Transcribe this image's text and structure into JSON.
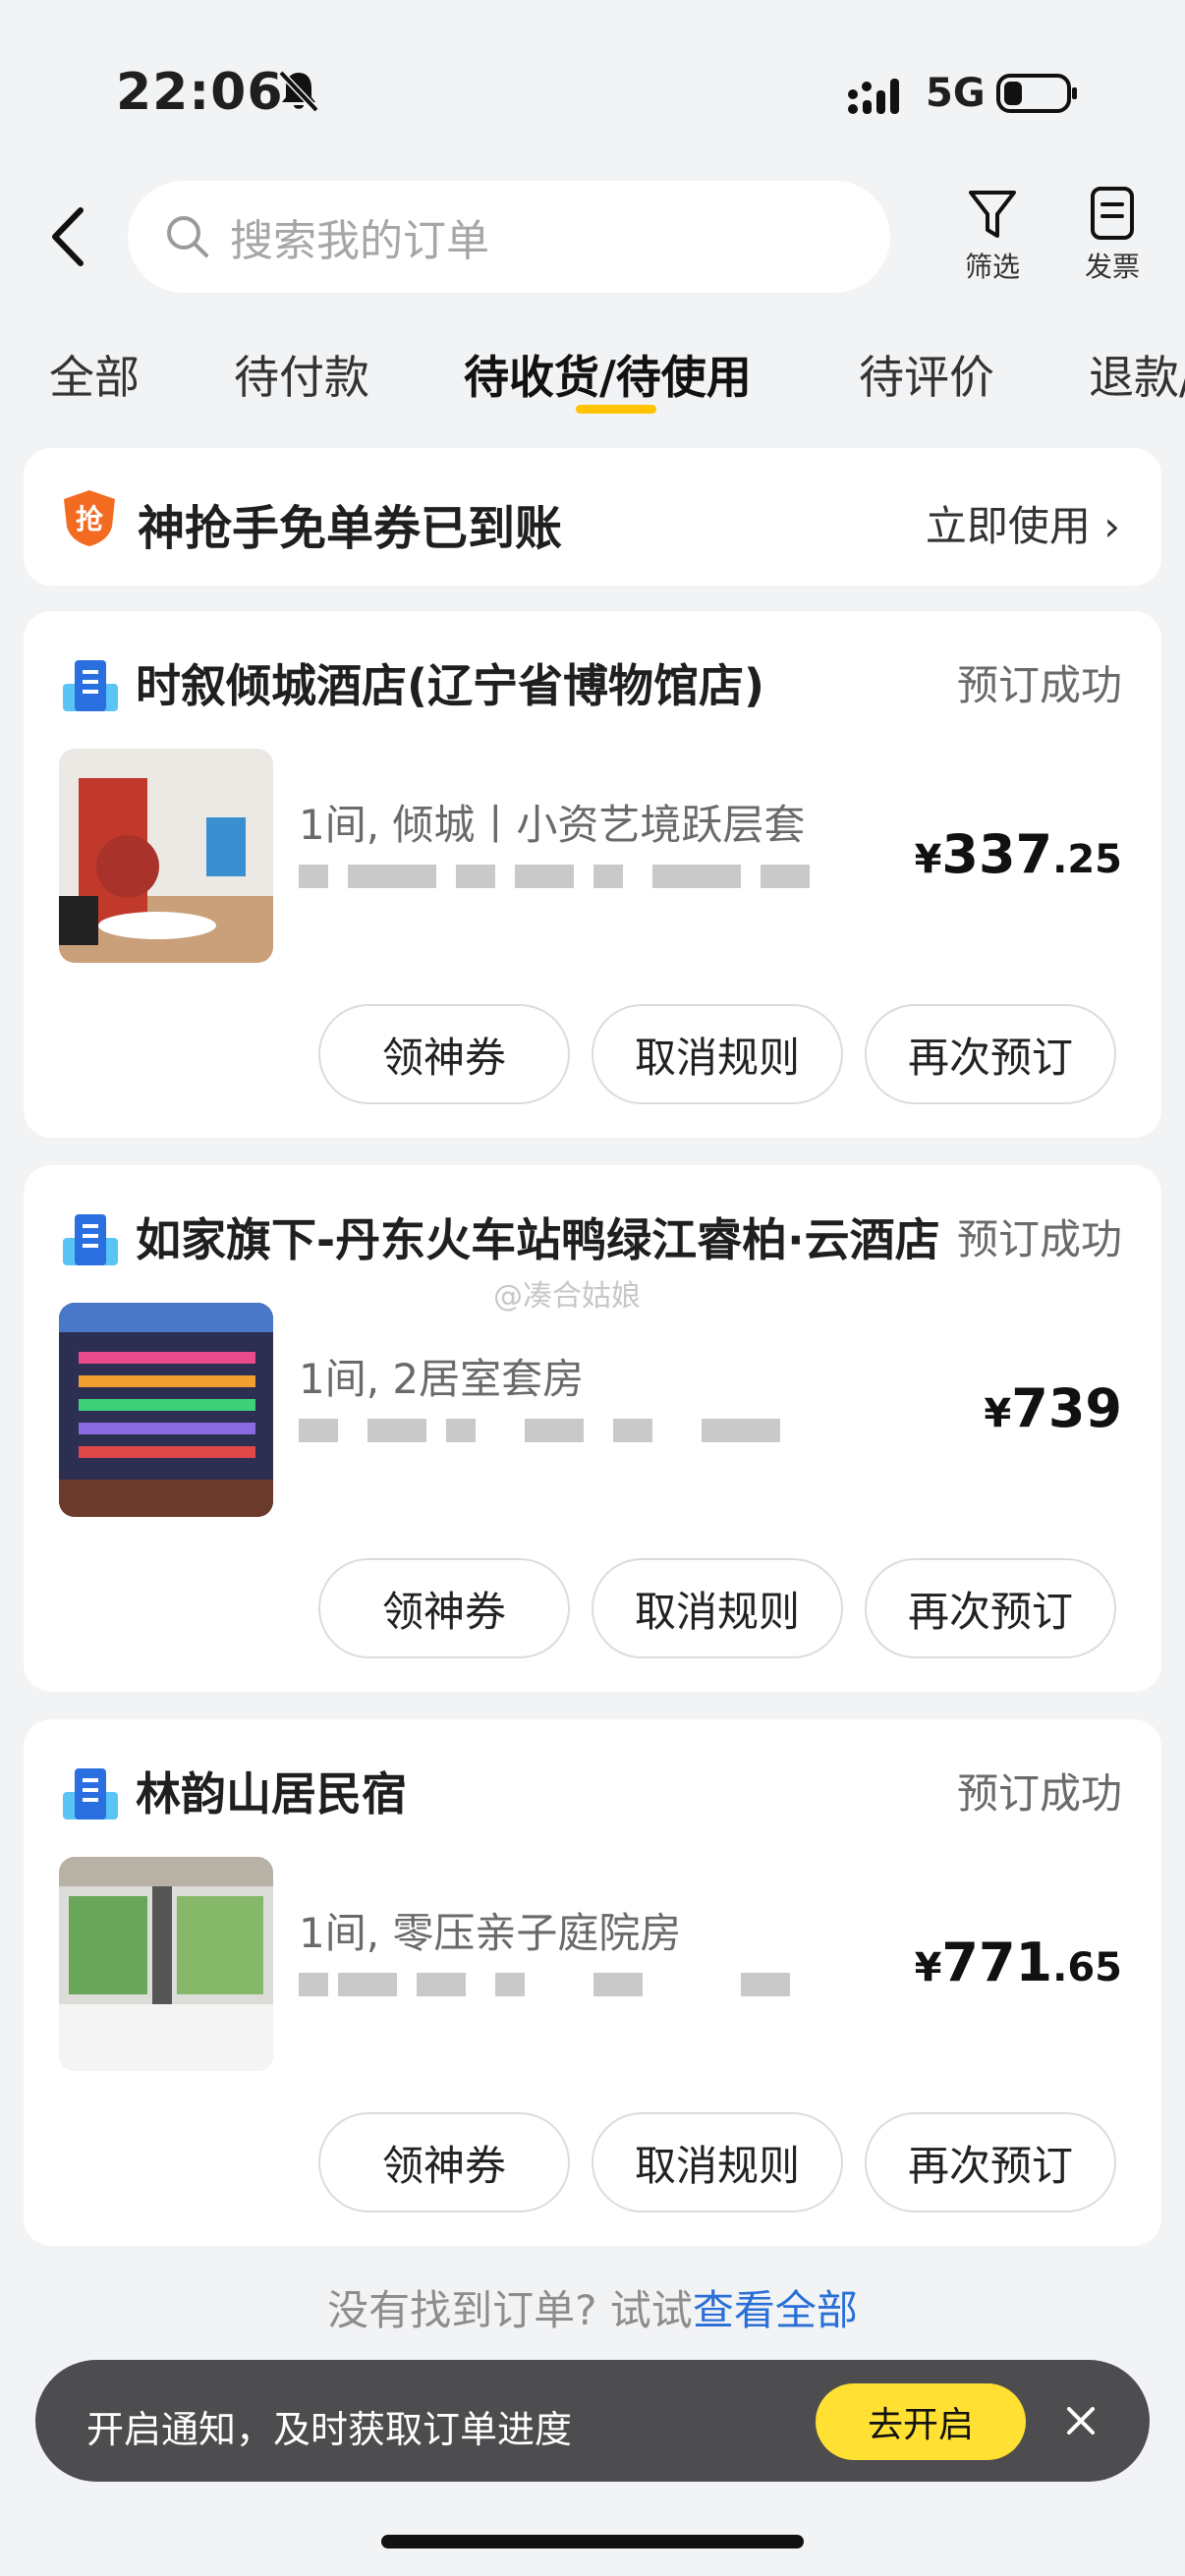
{
  "status_bar": {
    "time": "22:06",
    "network": "5G",
    "icons": [
      "bell-off-icon",
      "signal-icon",
      "battery-icon"
    ]
  },
  "header": {
    "back_icon": "chevron-left-icon",
    "search_placeholder": "搜索我的订单",
    "filter_label": "筛选",
    "invoice_label": "发票"
  },
  "tabs": [
    "全部",
    "待付款",
    "待收货/待使用",
    "待评价",
    "退款/"
  ],
  "active_tab": "待收货/待使用",
  "coupon_banner": {
    "text": "神抢手免单券已到账",
    "cta": "立即使用"
  },
  "orders": [
    {
      "hotel": "时叙倾城酒店(辽宁省博物馆店)",
      "status": "预订成功",
      "room": "1间, 倾城丨小资艺境跃层套",
      "price_currency": "¥",
      "price_int": "337",
      "price_dec": ".25",
      "buttons": [
        "领神券",
        "取消规则",
        "再次预订"
      ]
    },
    {
      "hotel": "如家旗下-丹东火车站鸭绿江睿柏·云酒店",
      "status": "预订成功",
      "room": "1间, 2居室套房",
      "price_currency": "¥",
      "price_int": "739",
      "price_dec": "",
      "buttons": [
        "领神券",
        "取消规则",
        "再次预订"
      ]
    },
    {
      "hotel": "林韵山居民宿",
      "status": "预订成功",
      "room": "1间, 零压亲子庭院房",
      "price_currency": "¥",
      "price_int": "771",
      "price_dec": ".65",
      "buttons": [
        "领神券",
        "取消规则",
        "再次预订"
      ]
    }
  ],
  "watermark": "@凑合姑娘",
  "footer": {
    "hint": "没有找到订单? 试试",
    "link": "查看全部"
  },
  "notify_bar": {
    "text": "开启通知，及时获取订单进度",
    "button": "去开启"
  },
  "colors": {
    "accent": "#ffc300",
    "link": "#2a6fd6",
    "notify_button": "#ffe033"
  }
}
